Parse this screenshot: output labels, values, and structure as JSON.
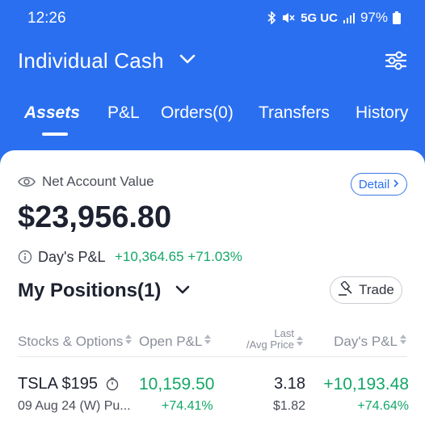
{
  "status": {
    "time": "12:26",
    "network": "5G UC",
    "battery": "97%"
  },
  "header": {
    "account": "Individual Cash"
  },
  "tabs": [
    {
      "label": "Assets"
    },
    {
      "label": "P&L"
    },
    {
      "label": "Orders(0)"
    },
    {
      "label": "Transfers"
    },
    {
      "label": "History"
    }
  ],
  "summary": {
    "nav_label": "Net Account Value",
    "detail_label": "Detail",
    "nav_value": "$23,956.80",
    "day_pl_label": "Day's P&L",
    "day_pl_amount": "+10,364.65",
    "day_pl_pct": "+71.03%"
  },
  "positions": {
    "title": "My Positions(1)",
    "trade_label": "Trade",
    "columns": {
      "stocks": "Stocks & Options",
      "open_pl": "Open P&L",
      "last_top": "Last",
      "last_bottom": "/Avg Price",
      "day_pl": "Day's P&L"
    },
    "rows": [
      {
        "symbol": "TSLA $195",
        "subtitle": "09 Aug 24 (W) Pu...",
        "open_pl": "10,159.50",
        "open_pl_pct": "+74.41%",
        "last": "3.18",
        "avg": "$1.82",
        "day_pl": "+10,193.48",
        "day_pl_pct": "+74.64%"
      }
    ]
  },
  "colors": {
    "brand_blue": "#2a6ff0",
    "gain_green": "#13a768"
  }
}
